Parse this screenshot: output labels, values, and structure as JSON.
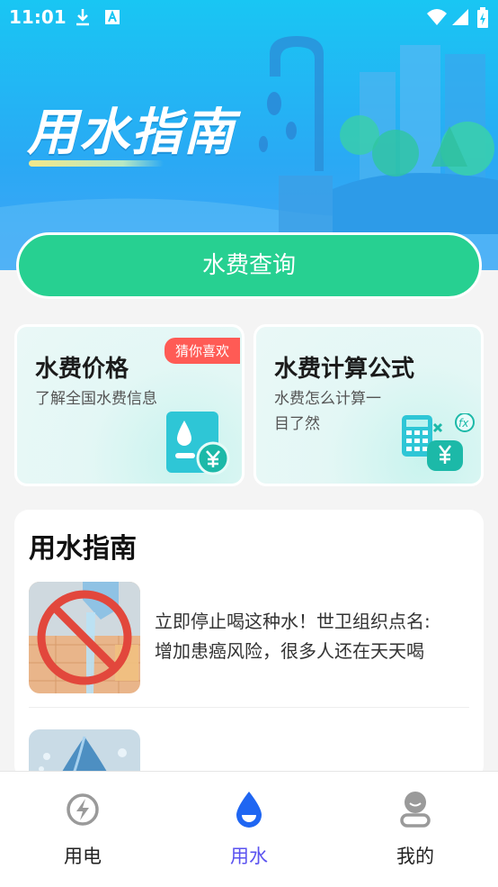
{
  "status": {
    "time": "11:01"
  },
  "hero": {
    "title": "用水指南"
  },
  "query_button": "水费查询",
  "cards": [
    {
      "title": "水费价格",
      "subtitle": "了解全国水费信息",
      "tag": "猜你喜欢"
    },
    {
      "title": "水费计算公式",
      "subtitle_line1": "水费怎么计算一",
      "subtitle_line2": "目了然"
    }
  ],
  "guide": {
    "title": "用水指南",
    "articles": [
      {
        "title_line1": "立即停止喝这种水！世卫组织点名:",
        "title_line2": "增加患癌风险，很多人还在天天喝"
      }
    ]
  },
  "tabbar": {
    "tabs": [
      {
        "label": "用电"
      },
      {
        "label": "用水"
      },
      {
        "label": "我的"
      }
    ]
  },
  "colors": {
    "accent_green": "#27d091",
    "active_tab": "#5a52f0",
    "tag_red": "#ff5b55"
  }
}
